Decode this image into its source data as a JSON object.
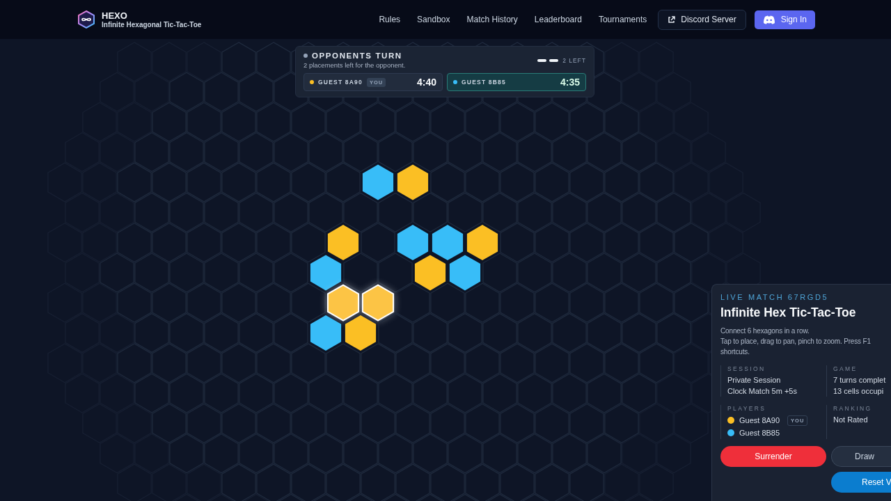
{
  "header": {
    "brand": "HEXO",
    "tagline": "Infinite Hexagonal Tic-Tac-Toe",
    "nav": [
      "Rules",
      "Sandbox",
      "Match History",
      "Leaderboard",
      "Tournaments"
    ],
    "discord_button": "Discord Server",
    "sign_in_button": "Sign In"
  },
  "turn_panel": {
    "title": "OPPONENTS TURN",
    "subtitle": "2 placements left for the opponent.",
    "remaining": "2 LEFT",
    "pips": [
      {
        "filled": true
      },
      {
        "filled": true
      }
    ],
    "players": [
      {
        "name": "GUEST 8A90",
        "badge": "YOU",
        "clock": "4:40",
        "color": "#fbbf24",
        "active": false
      },
      {
        "name": "GUEST 8B85",
        "clock": "4:35",
        "color": "#38bdf8",
        "active": true
      }
    ]
  },
  "board": {
    "rows": [
      {
        "cells": [
          {
            "kind": "empty",
            "last": false
          },
          {
            "kind": "empty",
            "last": false
          },
          {
            "kind": "opponent",
            "last": false
          },
          {
            "kind": "you",
            "last": false
          },
          {
            "kind": "empty",
            "last": false
          },
          {
            "kind": "empty",
            "last": false
          }
        ]
      },
      {
        "cells": [
          {
            "kind": "empty",
            "last": false
          },
          {
            "kind": "empty",
            "last": false
          },
          {
            "kind": "empty",
            "last": false
          },
          {
            "kind": "empty",
            "last": false
          },
          {
            "kind": "empty",
            "last": false
          }
        ]
      },
      {
        "cells": [
          {
            "kind": "empty",
            "last": false
          },
          {
            "kind": "you",
            "last": false
          },
          {
            "kind": "empty",
            "last": false
          },
          {
            "kind": "opponent",
            "last": false
          },
          {
            "kind": "opponent",
            "last": false
          },
          {
            "kind": "you",
            "last": false
          }
        ]
      },
      {
        "cells": [
          {
            "kind": "opponent",
            "last": false
          },
          {
            "kind": "empty",
            "last": false
          },
          {
            "kind": "empty",
            "last": false
          },
          {
            "kind": "you",
            "last": false
          },
          {
            "kind": "opponent",
            "last": false
          }
        ]
      },
      {
        "cells": [
          {
            "kind": "empty",
            "last": false
          },
          {
            "kind": "you",
            "last": true
          },
          {
            "kind": "you",
            "last": true
          },
          {
            "kind": "empty",
            "last": false
          },
          {
            "kind": "empty",
            "last": false
          },
          {
            "kind": "empty",
            "last": false
          }
        ]
      },
      {
        "cells": [
          {
            "kind": "opponent",
            "last": false
          },
          {
            "kind": "you",
            "last": false
          },
          {
            "kind": "empty",
            "last": false
          },
          {
            "kind": "empty",
            "last": false
          },
          {
            "kind": "empty",
            "last": false
          }
        ]
      }
    ]
  },
  "match_panel": {
    "eyebrow": "LIVE MATCH 67RGD5",
    "title": "Infinite Hex Tic-Tac-Toe",
    "description": [
      "Connect 6 hexagons in a row.",
      "Tap to place, drag to pan, pinch to zoom. Press F1",
      "shortcuts."
    ],
    "session": {
      "label": "SESSION",
      "lines": [
        "Private Session",
        "Clock Match 5m +5s"
      ]
    },
    "game": {
      "label": "GAME",
      "lines": [
        "7 turns complet",
        "13 cells occupi"
      ]
    },
    "players": {
      "label": "PLAYERS",
      "items": [
        {
          "name": "Guest 8A90",
          "badge": "YOU",
          "color": "#fbbf24"
        },
        {
          "name": "Guest 8B85",
          "color": "#38bdf8"
        }
      ]
    },
    "ranking": {
      "label": "RANKING",
      "lines": [
        "Not Rated"
      ]
    },
    "buttons": [
      {
        "label": "Surrender",
        "kind": "danger"
      },
      {
        "label": "Draw",
        "kind": "secondary"
      },
      {
        "label": "Reset V",
        "kind": "primary"
      }
    ]
  }
}
